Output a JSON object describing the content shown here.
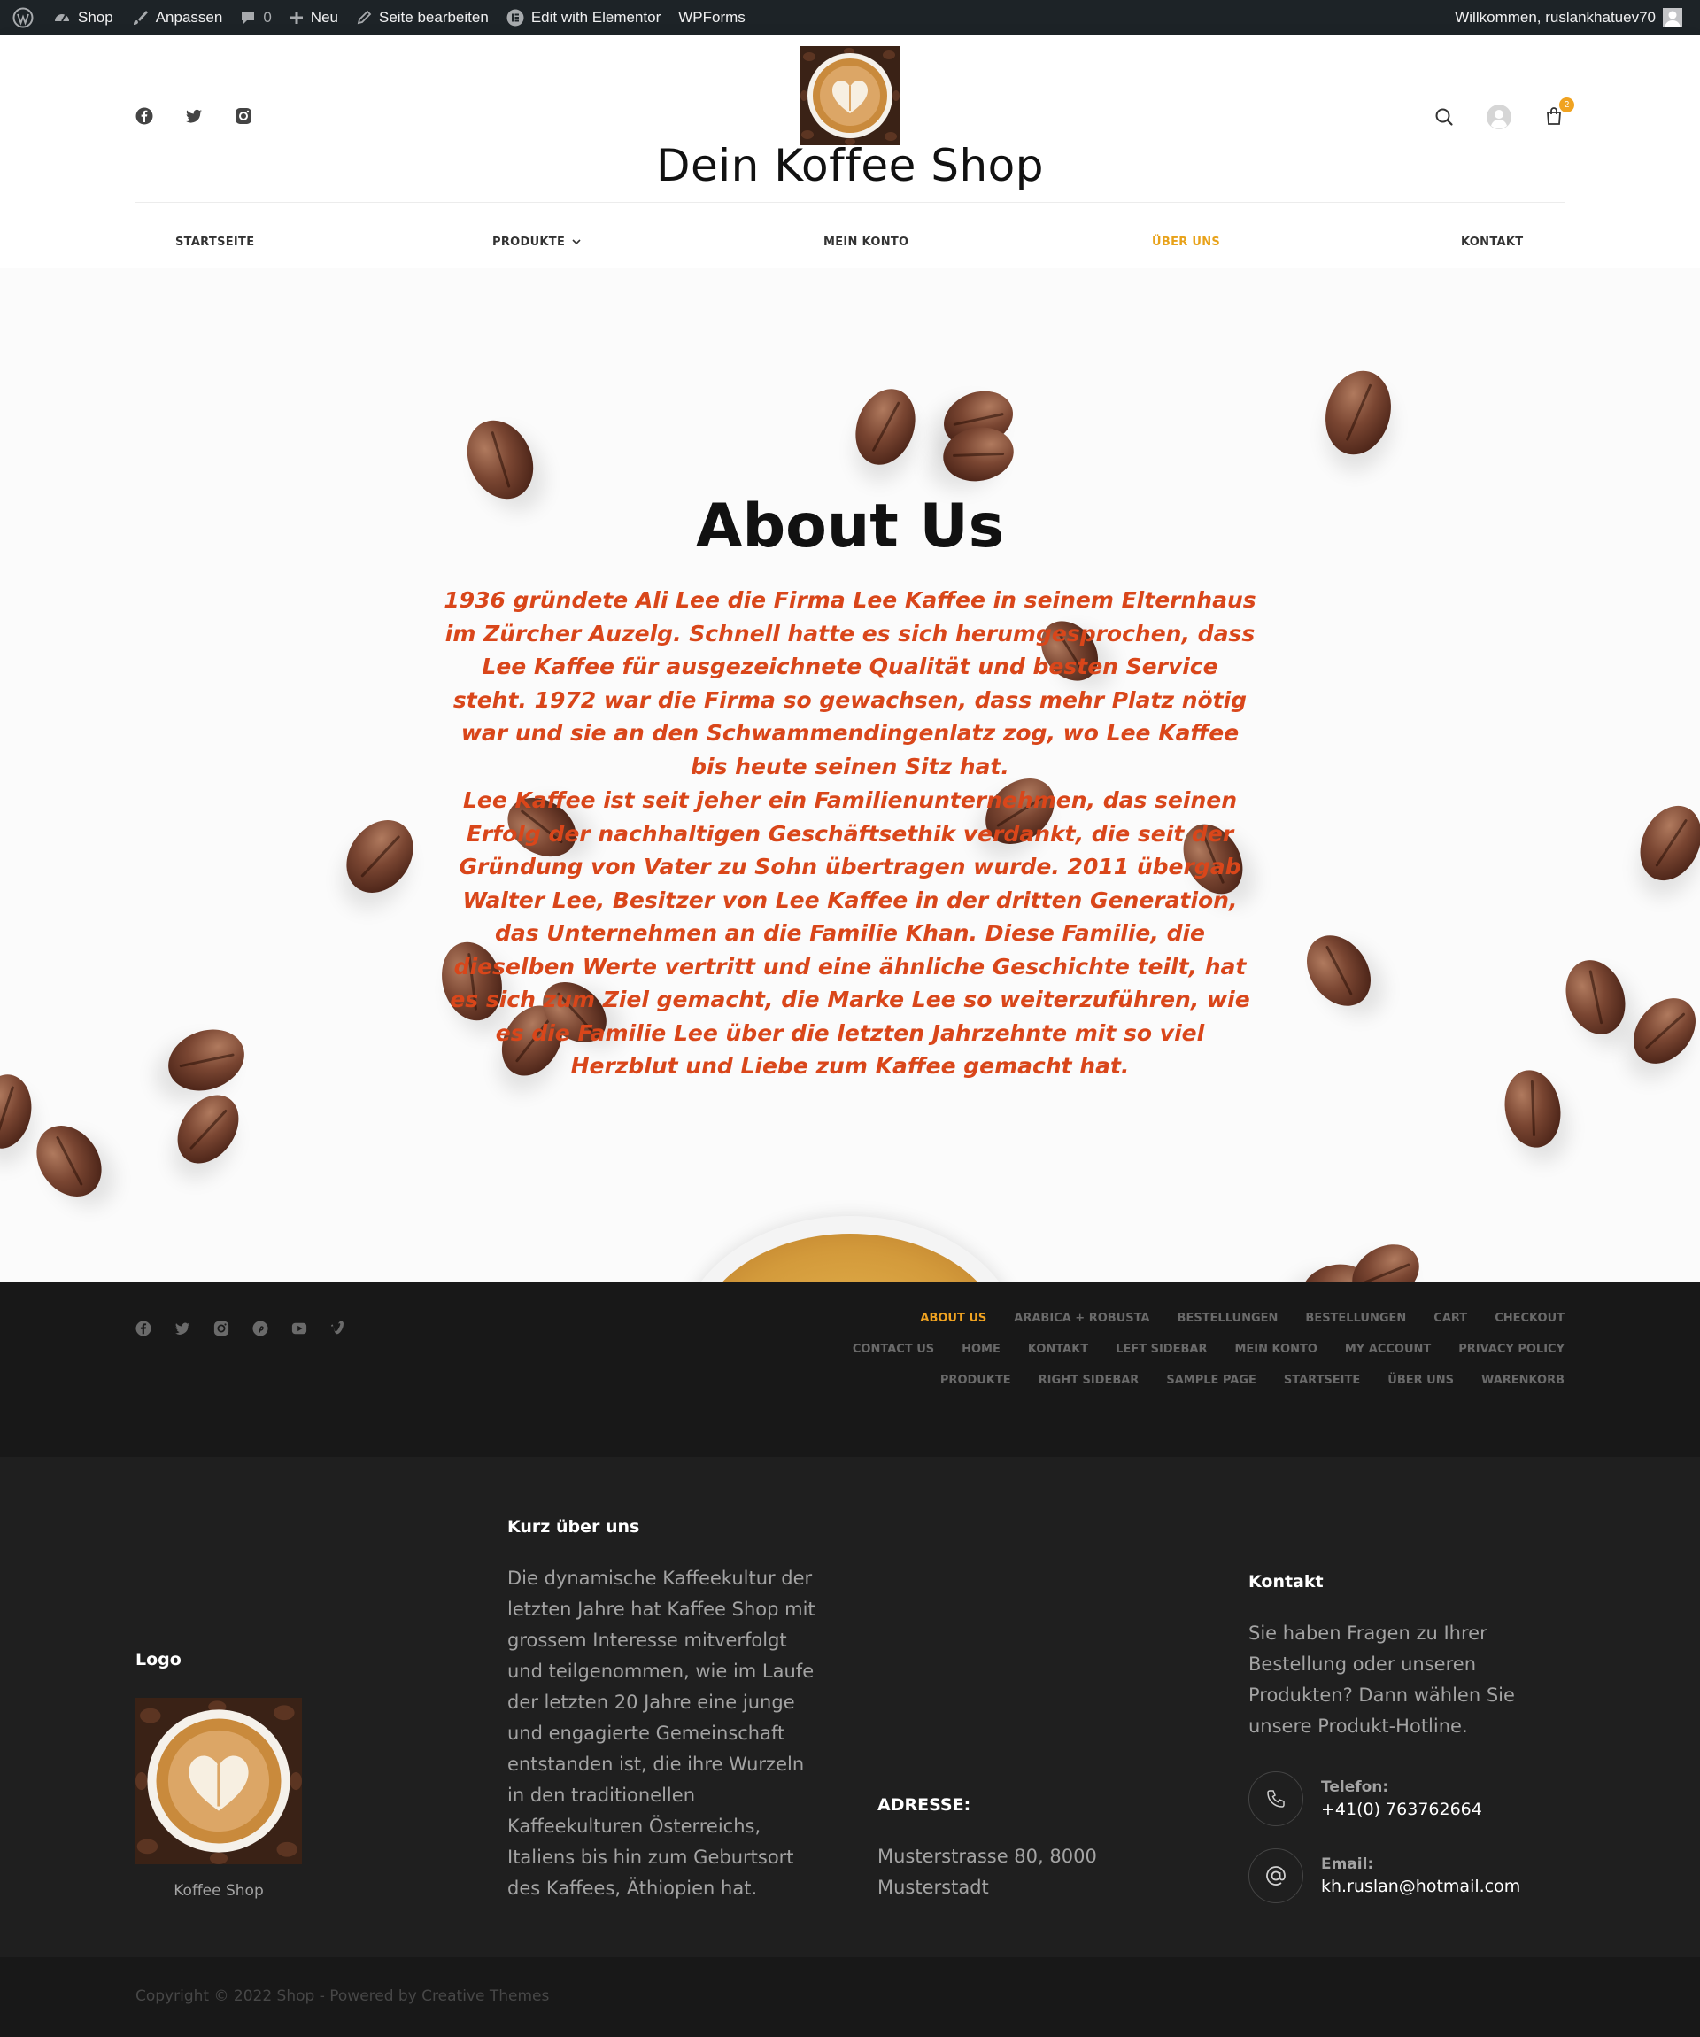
{
  "admin_bar": {
    "items": [
      {
        "label": "Shop",
        "icon": "dashboard-icon"
      },
      {
        "label": "Anpassen",
        "icon": "brush-icon"
      },
      {
        "label": "",
        "count": "0",
        "icon": "comment-icon"
      },
      {
        "label": "Neu",
        "icon": "plus-icon"
      },
      {
        "label": "Seite bearbeiten",
        "icon": "pencil-icon"
      },
      {
        "label": "Edit with Elementor",
        "icon": "elementor-icon"
      },
      {
        "label": "WPForms",
        "icon": ""
      }
    ],
    "greeting": "Willkommen, ruslankhatuev70"
  },
  "header": {
    "site_title": "Dein Koffee Shop",
    "social_icons": [
      "facebook-icon",
      "twitter-icon",
      "instagram-icon"
    ],
    "cart_count": "2",
    "nav": [
      {
        "label": "STARTSEITE",
        "active": false
      },
      {
        "label": "PRODUKTE",
        "active": false,
        "has_dropdown": true
      },
      {
        "label": "MEIN KONTO",
        "active": false
      },
      {
        "label": "ÜBER UNS",
        "active": true
      },
      {
        "label": "KONTAKT",
        "active": false
      }
    ]
  },
  "hero": {
    "title": "About Us",
    "paragraph_1": "1936 gründete Ali Lee die Firma Lee Kaffee in seinem Elternhaus im Zürcher Auzelg. Schnell hatte es sich herumgesprochen, dass Lee Kaffee für ausgezeichnete Qualität und besten Service steht. 1972 war die Firma so gewachsen, dass mehr Platz nötig war und sie an den Schwammendingenlatz zog, wo Lee Kaffee bis heute seinen Sitz hat.",
    "paragraph_2": "Lee Kaffee ist seit jeher ein Familienunternehmen, das seinen Erfolg der nachhaltigen Geschäftsethik verdankt, die seit der Gründung von Vater zu Sohn übertragen wurde. 2011 übergab Walter Lee, Besitzer von Lee Kaffee in der dritten Generation, das Unternehmen an die Familie Khan. Diese Familie, die dieselben Werte vertritt und eine ähnliche Geschichte teilt, hat es sich zum Ziel gemacht, die Marke Lee so weiterzuführen, wie es die Familie Lee über die letzten Jahrzehnte mit so viel Herzblut und Liebe zum Kaffee gemacht hat."
  },
  "footer_top": {
    "social_icons": [
      "facebook-icon",
      "twitter-icon",
      "instagram-icon",
      "pinterest-icon",
      "youtube-icon",
      "vimeo-icon"
    ],
    "menu": [
      {
        "label": "ABOUT US",
        "active": true
      },
      {
        "label": "ARABICA + ROBUSTA",
        "active": false
      },
      {
        "label": "BESTELLUNGEN",
        "active": false
      },
      {
        "label": "BESTELLUNGEN",
        "active": false
      },
      {
        "label": "CART",
        "active": false
      },
      {
        "label": "CHECKOUT",
        "active": false
      },
      {
        "label": "CONTACT US",
        "active": false
      },
      {
        "label": "HOME",
        "active": false
      },
      {
        "label": "KONTAKT",
        "active": false
      },
      {
        "label": "LEFT SIDEBAR",
        "active": false
      },
      {
        "label": "MEIN KONTO",
        "active": false
      },
      {
        "label": "MY ACCOUNT",
        "active": false
      },
      {
        "label": "PRIVACY POLICY",
        "active": false
      },
      {
        "label": "PRODUKTE",
        "active": false
      },
      {
        "label": "RIGHT SIDEBAR",
        "active": false
      },
      {
        "label": "SAMPLE PAGE",
        "active": false
      },
      {
        "label": "STARTSEITE",
        "active": false
      },
      {
        "label": "ÜBER UNS",
        "active": false
      },
      {
        "label": "WARENKORB",
        "active": false
      }
    ]
  },
  "footer_widgets": {
    "logo": {
      "title": "Logo",
      "caption": "Koffee Shop"
    },
    "about": {
      "title": "Kurz über uns",
      "text": "Die dynamische Kaffeekultur der letzten Jahre hat Kaffee Shop mit grossem Interesse mitverfolgt und teilgenommen, wie im Laufe der letzten 20 Jahre eine junge und engagierte Gemeinschaft entstanden ist, die ihre Wurzeln in den traditionellen Kaffeekulturen Österreichs, Italiens bis hin zum Geburtsort des Kaffees, Äthiopien hat."
    },
    "address": {
      "title": "ADRESSE:",
      "line_1": "Musterstrasse 80, 8000",
      "line_2": "Musterstadt"
    },
    "contact": {
      "title": "Kontakt",
      "text": "Sie haben Fragen zu Ihrer Bestellung oder unseren Produkten? Dann wählen Sie unsere Produkt-Hotline.",
      "phone_label": "Telefon:",
      "phone": "+41(0) 763762664",
      "email_label": "Email:",
      "email": "kh.ruslan@hotmail.com"
    }
  },
  "copyright": "Copyright © 2022 Shop - Powered by Creative Themes",
  "colors": {
    "accent": "#f0a321",
    "hero_text": "#d9461a",
    "admin_bar": "#1d2327",
    "footer_dark": "#181818",
    "footer_main": "#1f1f1f"
  }
}
